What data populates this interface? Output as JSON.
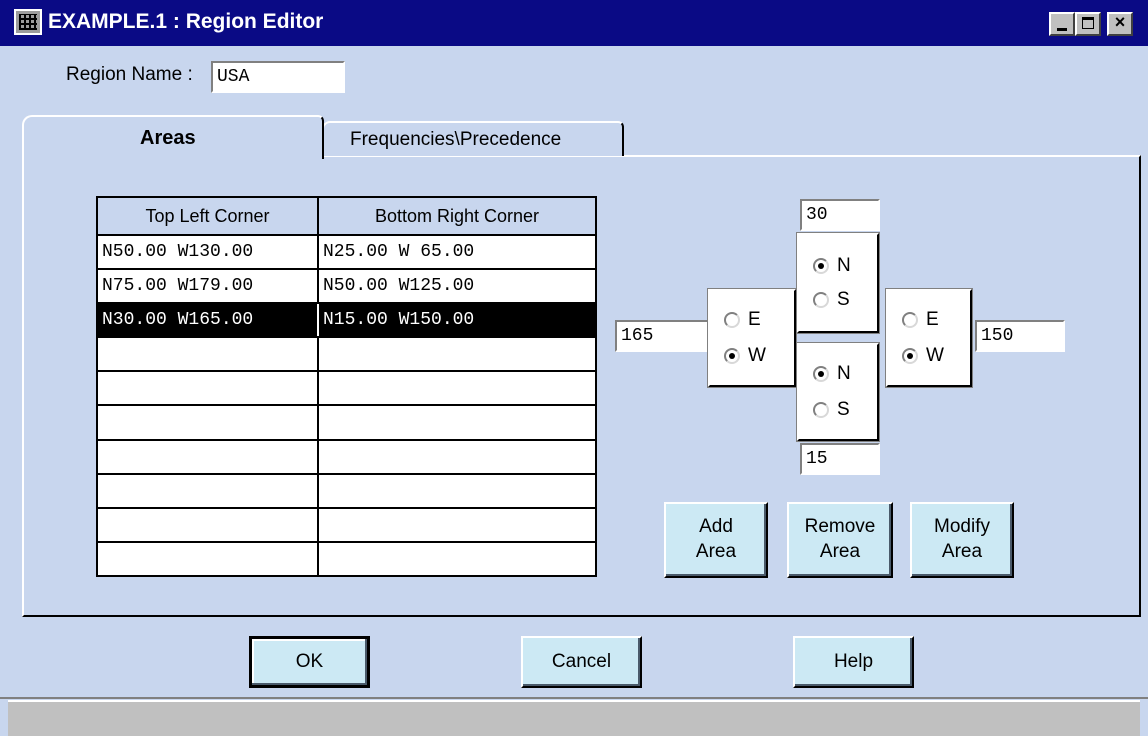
{
  "window": {
    "title": "EXAMPLE.1 : Region Editor",
    "minimize_icon": "minimize-icon",
    "maximize_icon": "maximize-icon",
    "close_icon": "close-icon",
    "close_glyph": "×"
  },
  "region": {
    "label": "Region Name :",
    "value": "USA"
  },
  "tabs": [
    {
      "label": "Areas",
      "active": true
    },
    {
      "label": "Frequencies\\Precedence",
      "active": false
    }
  ],
  "areas_table": {
    "headers": [
      "Top Left Corner",
      "Bottom Right Corner"
    ],
    "rows": [
      [
        "N50.00 W130.00",
        "N25.00 W 65.00"
      ],
      [
        "N75.00 W179.00",
        "N50.00 W125.00"
      ],
      [
        "N30.00 W165.00",
        "N15.00 W150.00"
      ],
      [
        "",
        ""
      ],
      [
        "",
        ""
      ],
      [
        "",
        ""
      ],
      [
        "",
        ""
      ],
      [
        "",
        ""
      ],
      [
        "",
        ""
      ],
      [
        "",
        ""
      ]
    ],
    "selected_row": 2
  },
  "coords": {
    "top_lat": "30",
    "top_lat_options": {
      "n": "N",
      "s": "S",
      "selected": "N"
    },
    "left_lon": "165",
    "left_lon_options": {
      "e": "E",
      "w": "W",
      "selected": "W"
    },
    "right_lon": "150",
    "right_lon_options": {
      "e": "E",
      "w": "W",
      "selected": "W"
    },
    "bottom_lat": "15",
    "bottom_lat_options": {
      "n": "N",
      "s": "S",
      "selected": "N"
    }
  },
  "area_buttons": {
    "add": [
      "Add",
      "Area"
    ],
    "remove": [
      "Remove",
      "Area"
    ],
    "modify": [
      "Modify",
      "Area"
    ]
  },
  "dialog_buttons": {
    "ok": "OK",
    "cancel": "Cancel",
    "help": "Help"
  },
  "colors": {
    "titlebar": "#0a0a85",
    "background": "#c8d6ee",
    "button": "#cce9f4"
  }
}
